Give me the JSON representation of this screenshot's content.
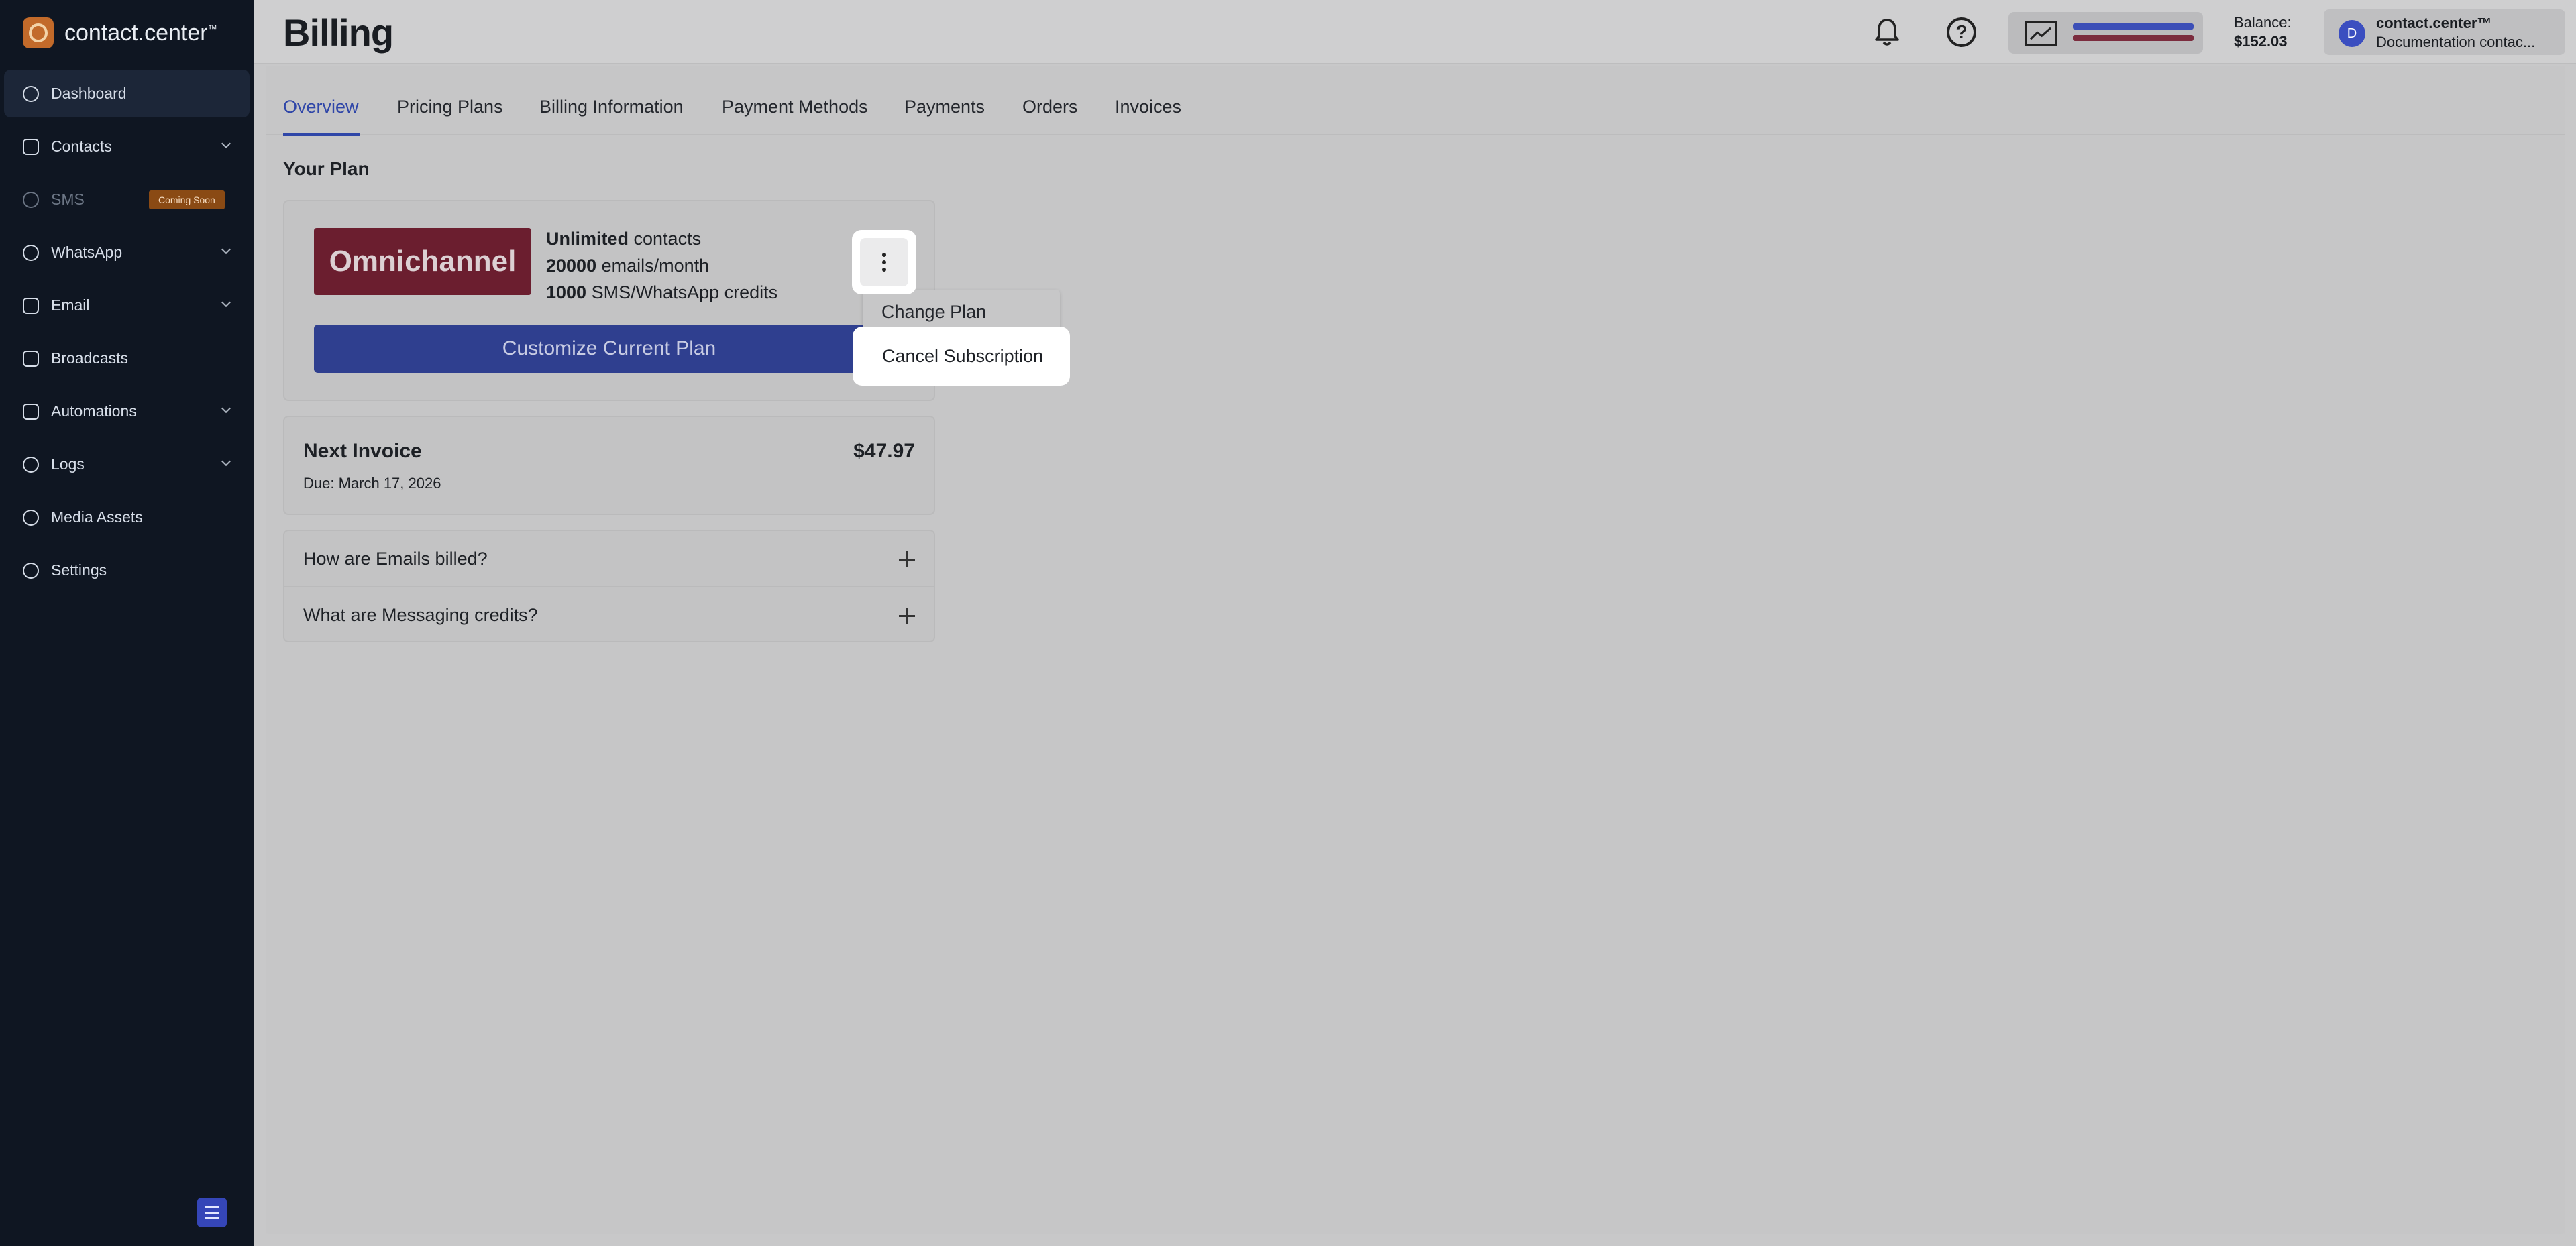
{
  "brand": {
    "name": "contact.center",
    "tm": "™"
  },
  "sidebar": {
    "items": [
      {
        "label": "Dashboard"
      },
      {
        "label": "Contacts"
      },
      {
        "label": "SMS",
        "badge": "Coming Soon"
      },
      {
        "label": "WhatsApp"
      },
      {
        "label": "Email"
      },
      {
        "label": "Broadcasts"
      },
      {
        "label": "Automations"
      },
      {
        "label": "Logs"
      },
      {
        "label": "Media Assets"
      },
      {
        "label": "Settings"
      }
    ]
  },
  "header": {
    "title": "Billing",
    "balance_label": "Balance:",
    "balance_value": "$152.03",
    "account_name": "contact.center™",
    "account_sub": "Documentation contac...",
    "avatar_letter": "D",
    "help_glyph": "?"
  },
  "tabs": [
    "Overview",
    "Pricing Plans",
    "Billing Information",
    "Payment Methods",
    "Payments",
    "Orders",
    "Invoices"
  ],
  "plan": {
    "section_title": "Your Plan",
    "name": "Omnichannel",
    "features": [
      {
        "bold": "Unlimited",
        "rest": " contacts"
      },
      {
        "bold": "20000",
        "rest": " emails/month"
      },
      {
        "bold": "1000",
        "rest": " SMS/WhatsApp credits"
      }
    ],
    "customize_label": "Customize Current Plan"
  },
  "menu": {
    "change_plan": "Change Plan",
    "cancel_subscription": "Cancel Subscription"
  },
  "invoice": {
    "title": "Next Invoice",
    "due": "Due: March 17, 2026",
    "amount": "$47.97"
  },
  "faq": [
    "How are Emails billed?",
    "What are Messaging credits?"
  ],
  "colors": {
    "accent": "#2f46a8",
    "plan_badge": "#6b1e2f",
    "brand": "#c26a2a"
  }
}
